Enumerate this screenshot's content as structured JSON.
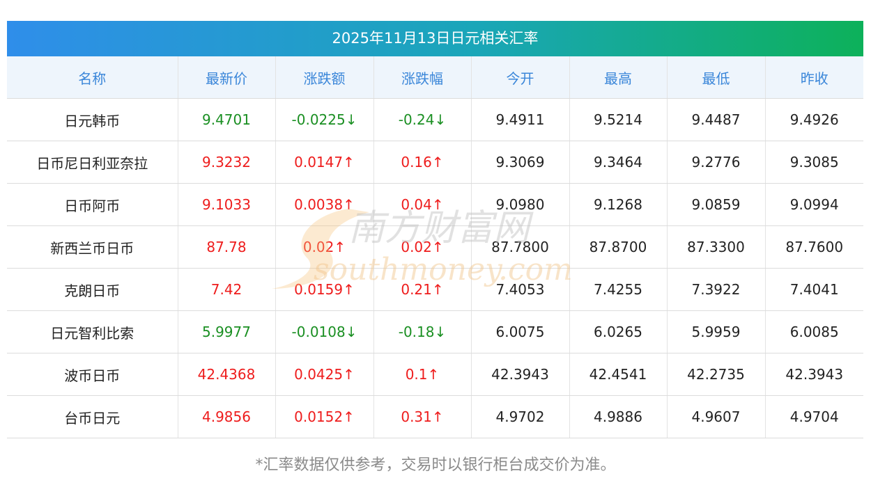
{
  "title": "2025年11月13日日元相关汇率",
  "headers": [
    "名称",
    "最新价",
    "涨跌额",
    "涨跌幅",
    "今开",
    "最高",
    "最低",
    "昨收"
  ],
  "rows": [
    {
      "name": "日元韩币",
      "latest": "9.4701",
      "change": "-0.0225↓",
      "pct": "-0.24↓",
      "open": "9.4911",
      "high": "9.5214",
      "low": "9.4487",
      "prev": "9.4926",
      "dir": "down"
    },
    {
      "name": "日币尼日利亚奈拉",
      "latest": "9.3232",
      "change": "0.0147↑",
      "pct": "0.16↑",
      "open": "9.3069",
      "high": "9.3464",
      "low": "9.2776",
      "prev": "9.3085",
      "dir": "up"
    },
    {
      "name": "日币阿币",
      "latest": "9.1033",
      "change": "0.0038↑",
      "pct": "0.04↑",
      "open": "9.0980",
      "high": "9.1268",
      "low": "9.0859",
      "prev": "9.0994",
      "dir": "up"
    },
    {
      "name": "新西兰币日币",
      "latest": "87.78",
      "change": "0.02↑",
      "pct": "0.02↑",
      "open": "87.7800",
      "high": "87.8700",
      "low": "87.3300",
      "prev": "87.7600",
      "dir": "up"
    },
    {
      "name": "克朗日币",
      "latest": "7.42",
      "change": "0.0159↑",
      "pct": "0.21↑",
      "open": "7.4053",
      "high": "7.4255",
      "low": "7.3922",
      "prev": "7.4041",
      "dir": "up"
    },
    {
      "name": "日元智利比索",
      "latest": "5.9977",
      "change": "-0.0108↓",
      "pct": "-0.18↓",
      "open": "6.0075",
      "high": "6.0265",
      "low": "5.9959",
      "prev": "6.0085",
      "dir": "down"
    },
    {
      "name": "波币日币",
      "latest": "42.4368",
      "change": "0.0425↑",
      "pct": "0.1↑",
      "open": "42.3943",
      "high": "42.4541",
      "low": "42.2735",
      "prev": "42.3943",
      "dir": "up"
    },
    {
      "name": "台币日元",
      "latest": "4.9856",
      "change": "0.0152↑",
      "pct": "0.31↑",
      "open": "4.9702",
      "high": "4.9886",
      "low": "4.9607",
      "prev": "4.9704",
      "dir": "up"
    }
  ],
  "note": "*汇率数据仅供参考，交易时以银行柜台成交价为准。",
  "watermark": {
    "cn": "南方财富网",
    "en": "southmoney.com"
  },
  "colors": {
    "up": "#ee1c1c",
    "down": "#1a8f22",
    "header_text": "#3a86d9"
  }
}
